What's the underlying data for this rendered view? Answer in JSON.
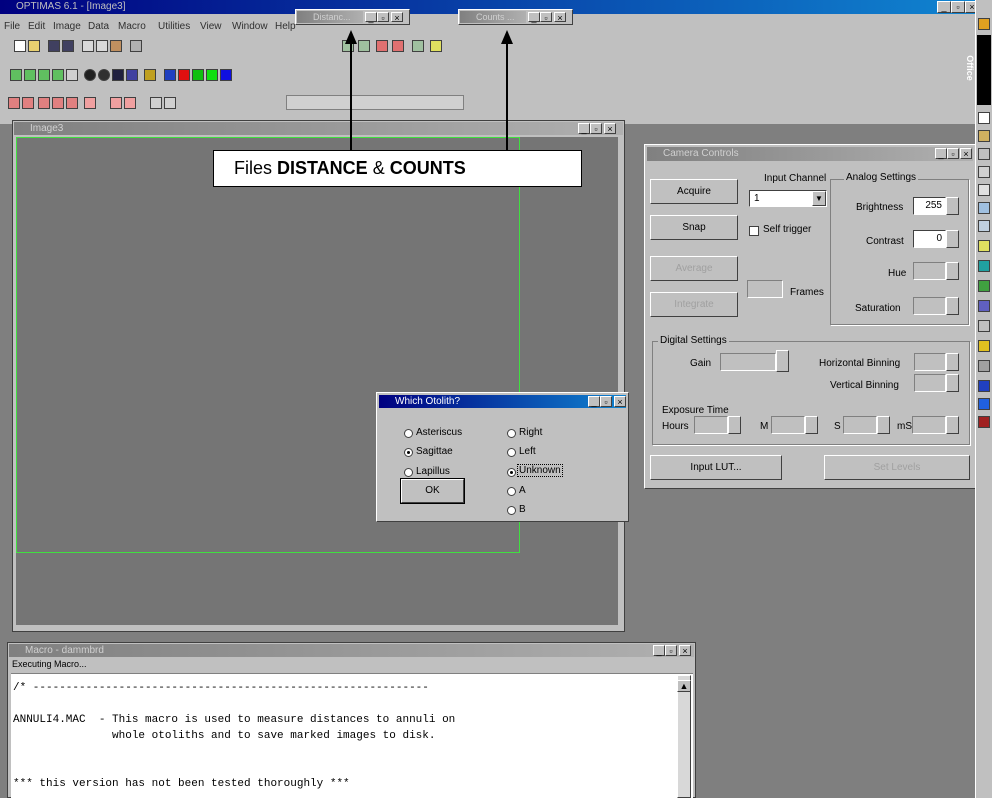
{
  "app": {
    "title": "OPTIMAS 6.1 - [Image3]",
    "menu": [
      "File",
      "Edit",
      "Image",
      "Data",
      "Macro",
      "Utilities",
      "View",
      "Window",
      "Help"
    ]
  },
  "mini_windows": [
    {
      "title": "Distanc..."
    },
    {
      "title": "Counts ..."
    }
  ],
  "annotation": {
    "prefix": "Files ",
    "b1": "DISTANCE",
    "mid": " & ",
    "b2": "COUNTS"
  },
  "image_window": {
    "title": "Image3"
  },
  "dialog": {
    "title": "Which Otolith?",
    "col1": [
      {
        "label": "Asteriscus",
        "checked": false
      },
      {
        "label": "Sagittae",
        "checked": true
      },
      {
        "label": "Lapillus",
        "checked": false
      }
    ],
    "col2": [
      {
        "label": "Right",
        "checked": false
      },
      {
        "label": "Left",
        "checked": false
      },
      {
        "label": "Unknown",
        "checked": true
      },
      {
        "label": "A",
        "checked": false
      },
      {
        "label": "B",
        "checked": false
      }
    ],
    "ok_label": "OK"
  },
  "camera": {
    "title": "Camera Controls",
    "acquire": "Acquire",
    "snap": "Snap",
    "average": "Average",
    "integrate": "Integrate",
    "input_channel_label": "Input Channel",
    "input_channel_value": "1",
    "self_trigger": "Self trigger",
    "frames_label": "Frames",
    "analog_label": "Analog Settings",
    "brightness_label": "Brightness",
    "brightness_value": "255",
    "contrast_label": "Contrast",
    "contrast_value": "0",
    "hue_label": "Hue",
    "saturation_label": "Saturation",
    "digital_label": "Digital Settings",
    "gain_label": "Gain",
    "hbin_label": "Horizontal Binning",
    "vbin_label": "Vertical Binning",
    "exposure_label": "Exposure Time",
    "hours_label": "Hours",
    "m_label": "M",
    "s_label": "S",
    "ms_label": "mS",
    "input_lut": "Input LUT...",
    "set_levels": "Set Levels"
  },
  "macro_window": {
    "title": "Macro - dammbrd",
    "status": "Executing Macro...",
    "lines": [
      "/* ------------------------------------------------------------",
      "",
      "ANNULI4.MAC  - This macro is used to measure distances to annuli on",
      "               whole otoliths and to save marked images to disk.",
      "",
      "",
      "*** this version has not been tested thoroughly ***"
    ]
  },
  "right_strip": {
    "label": "Office"
  }
}
